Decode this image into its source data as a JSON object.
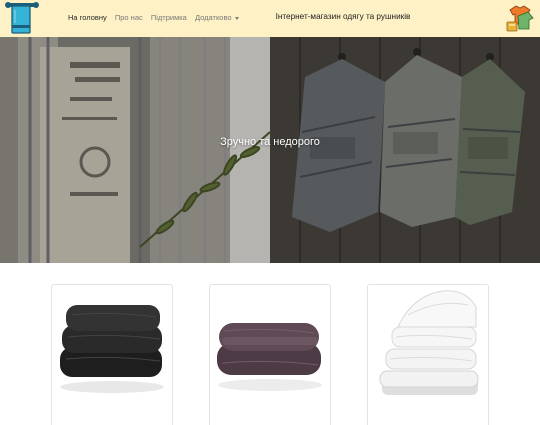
{
  "navbar": {
    "links": [
      {
        "label": "На головну",
        "active": true
      },
      {
        "label": "Про нас",
        "active": false
      },
      {
        "label": "Підтримка",
        "active": false
      },
      {
        "label": "Додатково",
        "active": false,
        "dropdown": true
      }
    ],
    "title": "Інтернет-магазин одягу та рушників",
    "logo_icon": "towel-rack-icon",
    "shop_icon": "clothes-shop-icon"
  },
  "hero": {
    "caption": "Зручно та недорого"
  },
  "products": [
    {
      "name": "black-towel-stack",
      "color": "#2e2e2e"
    },
    {
      "name": "plum-towel-stack",
      "color": "#5a4650"
    },
    {
      "name": "white-towel-stack",
      "color": "#f1f1f1"
    }
  ]
}
